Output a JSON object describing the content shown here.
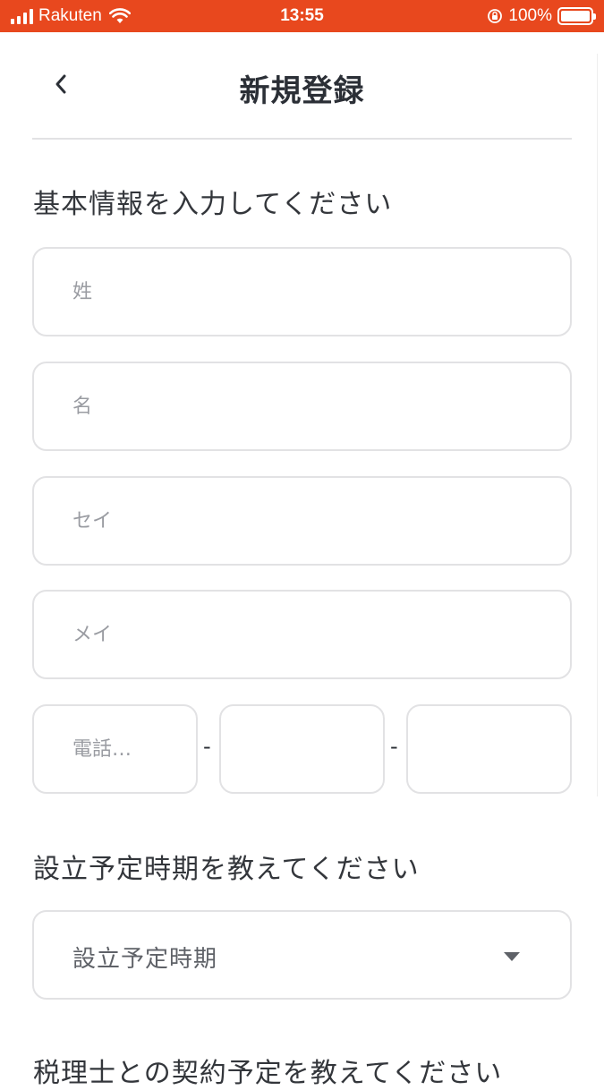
{
  "status_bar": {
    "carrier": "Rakuten",
    "time": "13:55",
    "battery": "100%"
  },
  "header": {
    "title": "新規登録",
    "back_icon": "chevron-left-icon"
  },
  "basic_info": {
    "heading": "基本情報を入力してください",
    "last_name_placeholder": "姓",
    "first_name_placeholder": "名",
    "last_name_kana_placeholder": "セイ",
    "first_name_kana_placeholder": "メイ",
    "phone_placeholder": "電話…",
    "phone_separator": "-"
  },
  "founding": {
    "heading": "設立予定時期を教えてください",
    "select_value": "設立予定時期",
    "select_icon": "caret-down-icon"
  },
  "tax_accountant": {
    "heading": "税理士との契約予定を教えてください"
  },
  "colors": {
    "status_bar": "#e8481e",
    "border": "#e2e2e4",
    "text": "#2b2f36",
    "placeholder": "#9a9ca2"
  }
}
